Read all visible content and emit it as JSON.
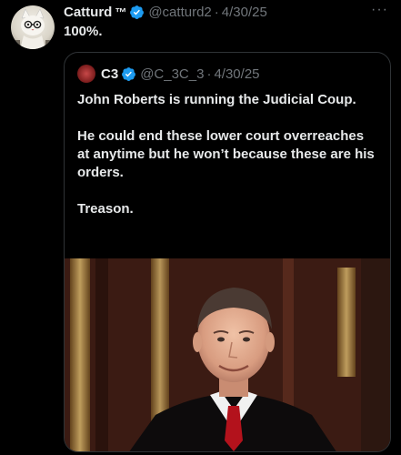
{
  "tweet": {
    "author": {
      "display_name": "Catturd",
      "tm": "™",
      "handle": "@catturd2",
      "date": "4/30/25"
    },
    "dot": "·",
    "text": "100%.",
    "more": "···"
  },
  "quoted_tweet": {
    "author": {
      "display_name": "C3",
      "handle": "@C_3C_3",
      "date": "4/30/25"
    },
    "dot": "·",
    "paragraphs": [
      "John Roberts is running the Judicial Coup.",
      "He could end these lower court overreaches at anytime but he won’t because these are his orders.",
      "Treason."
    ]
  },
  "colors": {
    "background": "#000000",
    "text": "#e7e9ea",
    "muted": "#71767b",
    "verified": "#1d9bf0",
    "border": "#2f3336"
  }
}
